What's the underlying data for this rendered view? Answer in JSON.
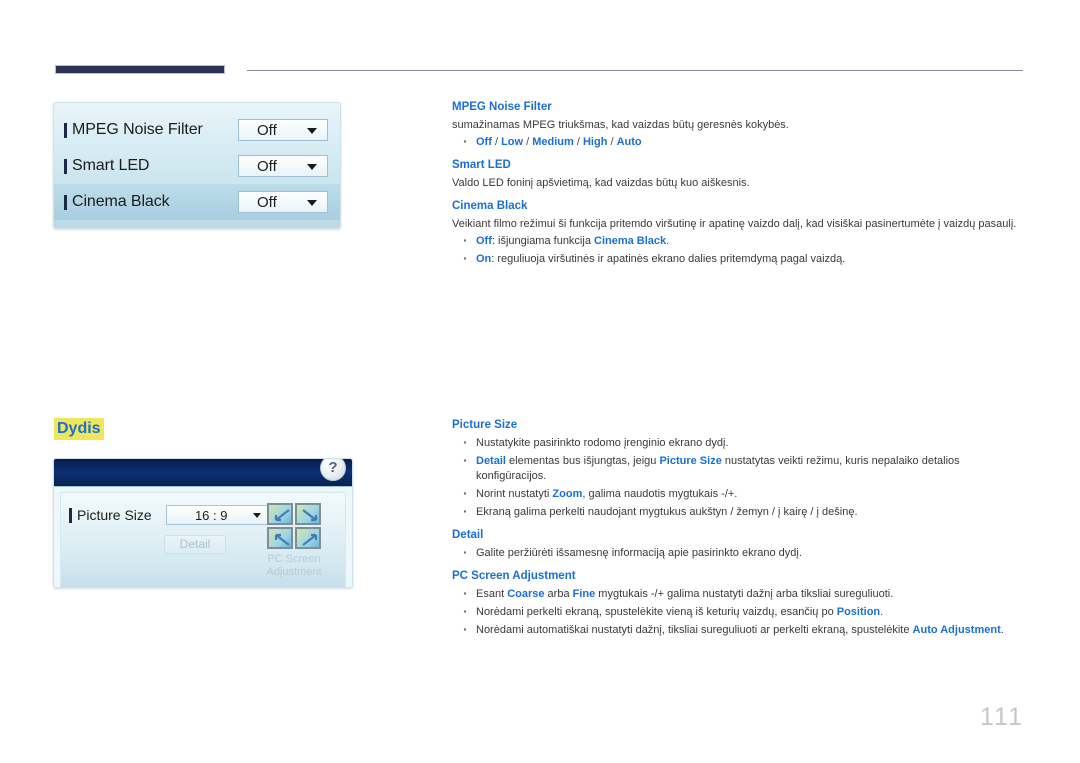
{
  "page": {
    "number": "111"
  },
  "header": {
    "rule_color": "#2e3255"
  },
  "osd_panel_1": {
    "name": "picture-options-osd",
    "rows": [
      {
        "label": "MPEG Noise Filter",
        "value": "Off",
        "highlighted": false
      },
      {
        "label": "Smart LED",
        "value": "Off",
        "highlighted": false
      },
      {
        "label": "Cinema Black",
        "value": "Off",
        "highlighted": true
      }
    ]
  },
  "section": {
    "heading": "Dydis",
    "heading_color": "#1a6fd4",
    "highlight_color": "#efe659"
  },
  "osd_panel_2": {
    "name": "picture-size-osd",
    "help_glyph": "?",
    "picture_size_label": "Picture Size",
    "picture_size_value": "16 : 9",
    "detail_button": "Detail",
    "pc_adjustment_caption_line1": "PC Screen",
    "pc_adjustment_caption_line2": "Adjustment"
  },
  "content_top": {
    "heading_mpeg": "MPEG Noise Filter",
    "para_mpeg": "sumažinamas MPEG triukšmas, kad vaizdas būtų geresnės kokybės.",
    "options_mpeg": [
      "Off",
      "Low",
      "Medium",
      "High",
      "Auto"
    ],
    "options_separator": " / ",
    "heading_smart_led": "Smart LED",
    "para_smart_led": "Valdo LED foninį apšvietimą, kad vaizdas būtų kuo aiškesnis.",
    "heading_cinema_black": "Cinema Black",
    "para_cinema_black": "Veikiant filmo režimui ši funkcija pritemdo viršutinę ir apatinę vaizdo dalį, kad visiškai pasinertumėte į vaizdų pasaulį.",
    "bullet_off_key": "Off",
    "bullet_off_text": ": išjungiama funkcija ",
    "bullet_off_term": "Cinema Black",
    "bullet_off_end": ".",
    "bullet_on_key": "On",
    "bullet_on_text": ": reguliuoja viršutinės ir apatinės ekrano dalies pritemdymą pagal vaizdą."
  },
  "content_bottom": {
    "heading_picture_size": "Picture Size",
    "ps_b1": "Nustatykite pasirinkto rodomo įrenginio ekrano dydį.",
    "ps_b2_term1": "Detail",
    "ps_b2_mid1": " elementas bus išjungtas, jeigu ",
    "ps_b2_term2": "Picture Size",
    "ps_b2_end": " nustatytas veikti režimu, kuris nepalaiko detalios konfigūracijos.",
    "ps_b3_start": "Norint nustatyti ",
    "ps_b3_term": "Zoom",
    "ps_b3_end": ", galima naudotis mygtukais -/+.",
    "ps_b4": "Ekraną galima perkelti naudojant mygtukus aukštyn / žemyn / į kairę / į dešinę.",
    "heading_detail": "Detail",
    "detail_b1": "Galite peržiūrėti išsamesnę informaciją apie pasirinkto ekrano dydį.",
    "heading_pc_screen": "PC Screen Adjustment",
    "pc_b1_start": "Esant ",
    "pc_b1_term1": "Coarse",
    "pc_b1_mid": " arba ",
    "pc_b1_term2": "Fine",
    "pc_b1_end": " mygtukais -/+ galima nustatyti dažnį arba tiksliai sureguliuoti.",
    "pc_b2_start": "Norėdami perkelti ekraną, spustelėkite vieną iš keturių vaizdų, esančių po ",
    "pc_b2_term": "Position",
    "pc_b2_end": ".",
    "pc_b3_start": "Norėdami automatiškai nustatyti dažnį, tiksliai sureguliuoti ar perkelti ekraną, spustelėkite ",
    "pc_b3_term": "Auto Adjustment",
    "pc_b3_end": "."
  }
}
